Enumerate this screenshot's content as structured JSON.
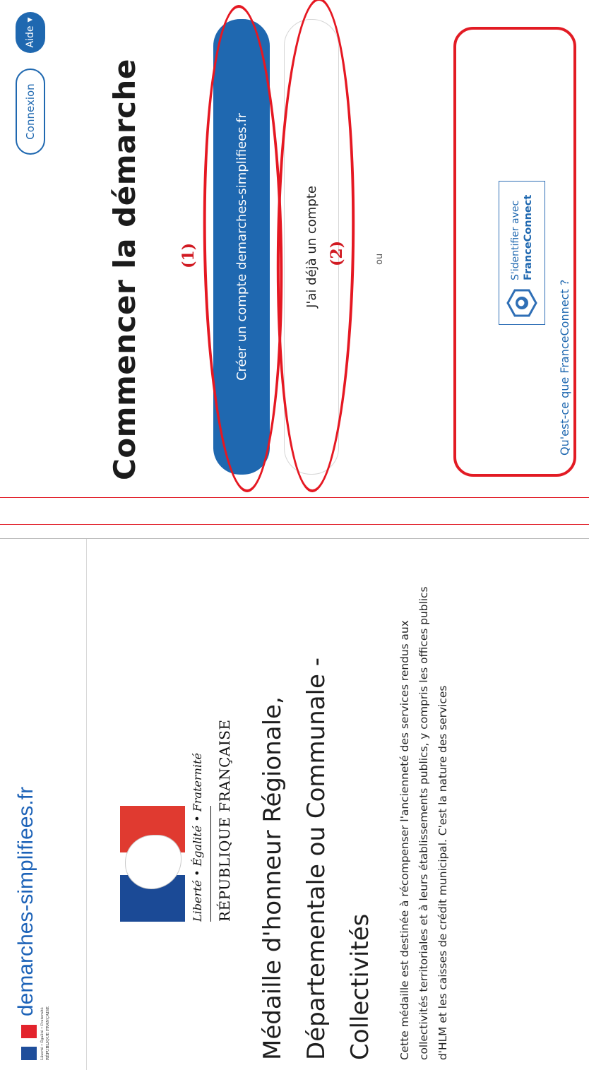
{
  "header": {
    "site_title": "demarches-simplifiees.fr",
    "logo_small_line1": "Liberté • Égalité • Fraternité",
    "logo_small_line2": "RÉPUBLIQUE FRANÇAISE"
  },
  "nav": {
    "login_label": "Connexion",
    "help_label": "Aide",
    "help_caret": "▼"
  },
  "logo": {
    "motto": "Liberté • Égalité • Fraternité",
    "republic": "RÉPUBLIQUE FRANÇAISE"
  },
  "procedure": {
    "title": "Médaille d'honneur Régionale, Départementale ou Communale - Collectivités",
    "description": "Cette médaille est destinée à récompenser l'ancienneté des services rendus aux collectivités territoriales et à leurs établissements publics, y compris les offices publics d'HLM et les caisses de crédit municipal. C'est la nature des services"
  },
  "start": {
    "heading": "Commencer la démarche",
    "create_account_label": "Créer un compte demarches-simplifiees.fr",
    "existing_account_label": "J'ai déjà un compte",
    "or_label": "ou"
  },
  "annotations": {
    "label_1": "(1)",
    "label_2": "(2)"
  },
  "franceconnect": {
    "line1": "S'identifier avec",
    "line2": "FranceConnect",
    "help_link": "Qu'est-ce que FranceConnect ?"
  },
  "colors": {
    "primary": "#1f68b0",
    "annotation_red": "#e51822",
    "flag_blue": "#1b4a96",
    "flag_red": "#e03a30"
  }
}
